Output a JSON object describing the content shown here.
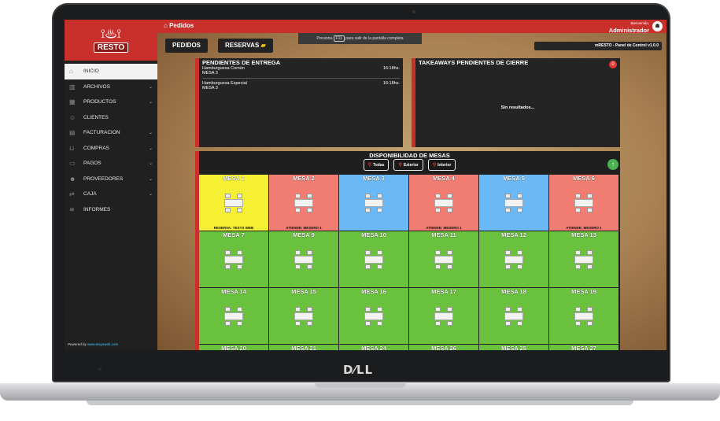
{
  "device": {
    "brand": "D⁄LL"
  },
  "app": {
    "logo_text": "RESTO",
    "page_title": "Pedidos",
    "user": {
      "greeting": "Bienvenido,",
      "name": "Administrador"
    },
    "version": "mRESTO - Panel de Control v1.0.0",
    "fullscreen_note": {
      "before": "Presiona",
      "key": "F11",
      "after": "para salir de la pantalla completa"
    },
    "powered": {
      "prefix": "Powered by",
      "link": "www.tesysweb.com"
    }
  },
  "sidebar": {
    "items": [
      {
        "label": "INICIO",
        "icon": "home-icon",
        "glyph": "⌂",
        "chevron": false,
        "active": true
      },
      {
        "label": "ARCHIVOS",
        "icon": "archive-icon",
        "glyph": "▥",
        "chevron": true
      },
      {
        "label": "PRODUCTOS",
        "icon": "products-icon",
        "glyph": "▦",
        "chevron": true
      },
      {
        "label": "CLIENTES",
        "icon": "clients-icon",
        "glyph": "☺",
        "chevron": false
      },
      {
        "label": "FACTURACION",
        "icon": "invoice-icon",
        "glyph": "▤",
        "chevron": true
      },
      {
        "label": "COMPRAS",
        "icon": "cart-icon",
        "glyph": "⊔",
        "chevron": true
      },
      {
        "label": "PAGOS",
        "icon": "payments-icon",
        "glyph": "▭",
        "chevron": true
      },
      {
        "label": "PROVEEDORES",
        "icon": "suppliers-icon",
        "glyph": "☻",
        "chevron": true
      },
      {
        "label": "CAJA",
        "icon": "cash-icon",
        "glyph": "⇄",
        "chevron": true
      },
      {
        "label": "INFORMES",
        "icon": "reports-icon",
        "glyph": "≋",
        "chevron": false
      }
    ]
  },
  "toolbar": {
    "pedidos_label": "PEDIDOS",
    "reservas_label": "RESERVAS"
  },
  "pending_delivery": {
    "title": "PENDIENTES DE ENTREGA",
    "orders": [
      {
        "item": "Hamburguesa Común",
        "table": "MESA 3",
        "time": "16:18hs."
      },
      {
        "item": "Hamburguesa Especial",
        "table": "MESA 3",
        "time": "16:18hs."
      }
    ]
  },
  "takeaways": {
    "title": "TAKEAWAYS PENDIENTES DE CIERRE",
    "count": "0",
    "empty": "Sin resultados..."
  },
  "availability": {
    "title": "DISPONIBILIDAD DE MESAS",
    "filters": [
      "Todas",
      "Exterior",
      "Interior"
    ],
    "colors": {
      "reserved": "#f5f033",
      "occupied": "#f07c72",
      "ordered": "#6ab8f5",
      "free": "#6ac13d"
    },
    "tables": [
      {
        "name": "MESA 1",
        "status": "reserved",
        "info": "RESERVA: TESYS WEB"
      },
      {
        "name": "MESA 2",
        "status": "occupied",
        "info": "ATIENDE: MESERO 1"
      },
      {
        "name": "MESA 3",
        "status": "ordered",
        "info": ""
      },
      {
        "name": "MESA 4",
        "status": "occupied",
        "info": "ATIENDE: MESERO 1"
      },
      {
        "name": "MESA 5",
        "status": "ordered",
        "info": ""
      },
      {
        "name": "MESA 6",
        "status": "occupied",
        "info": "ATIENDE: MESERO 1"
      },
      {
        "name": "MESA 7",
        "status": "free",
        "info": ""
      },
      {
        "name": "MESA 9",
        "status": "free",
        "info": ""
      },
      {
        "name": "MESA 10",
        "status": "free",
        "info": ""
      },
      {
        "name": "MESA 11",
        "status": "free",
        "info": ""
      },
      {
        "name": "MESA 12",
        "status": "free",
        "info": ""
      },
      {
        "name": "MESA 13",
        "status": "free",
        "info": ""
      },
      {
        "name": "MESA 14",
        "status": "free",
        "info": ""
      },
      {
        "name": "MESA 15",
        "status": "free",
        "info": ""
      },
      {
        "name": "MESA 16",
        "status": "free",
        "info": ""
      },
      {
        "name": "MESA 17",
        "status": "free",
        "info": ""
      },
      {
        "name": "MESA 18",
        "status": "free",
        "info": ""
      },
      {
        "name": "MESA 19",
        "status": "free",
        "info": ""
      },
      {
        "name": "MESA 20",
        "status": "free",
        "info": ""
      },
      {
        "name": "MESA 21",
        "status": "free",
        "info": ""
      },
      {
        "name": "MESA 24",
        "status": "free",
        "info": ""
      },
      {
        "name": "MESA 26",
        "status": "free",
        "info": ""
      },
      {
        "name": "MESA 25",
        "status": "free",
        "info": ""
      },
      {
        "name": "MESA 27",
        "status": "free",
        "info": ""
      }
    ]
  }
}
